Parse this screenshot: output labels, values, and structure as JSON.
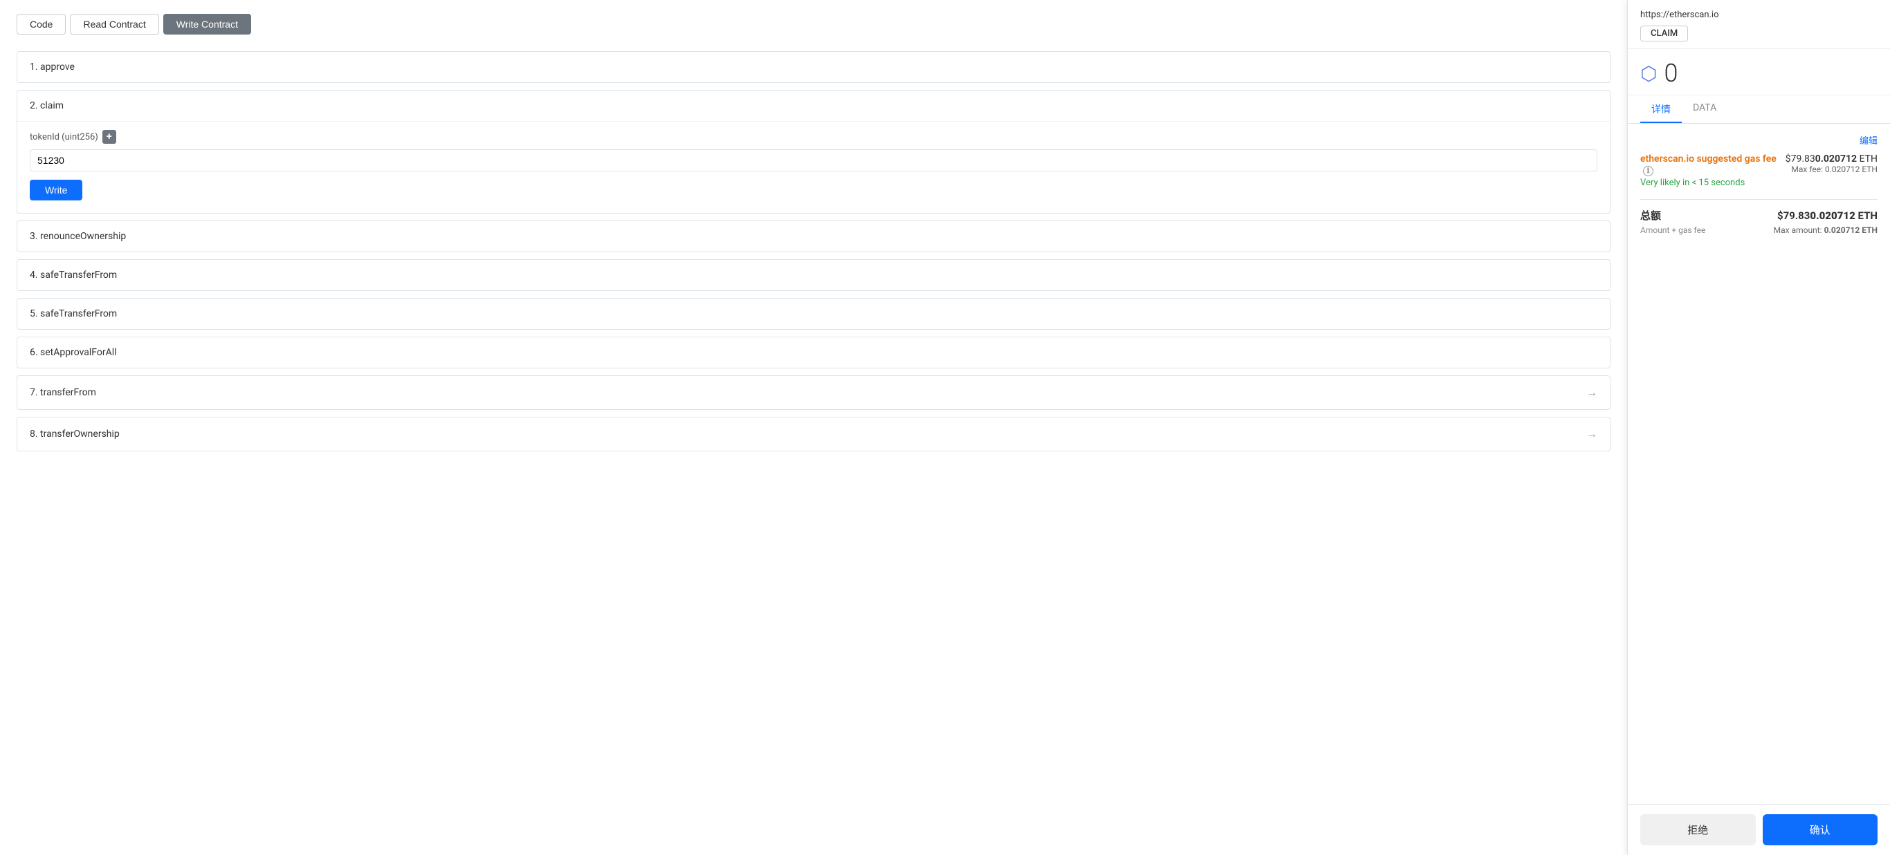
{
  "tabs": {
    "code": "Code",
    "read_contract": "Read Contract",
    "write_contract": "Write Contract",
    "active": "write_contract"
  },
  "contract_items": [
    {
      "id": 1,
      "label": "1. approve",
      "has_arrow": false
    },
    {
      "id": 2,
      "label": "2. claim",
      "expanded": true
    },
    {
      "id": 3,
      "label": "3. renounceOwnership",
      "has_arrow": false
    },
    {
      "id": 4,
      "label": "4. safeTransferFrom",
      "has_arrow": false
    },
    {
      "id": 5,
      "label": "5. safeTransferFrom",
      "has_arrow": false
    },
    {
      "id": 6,
      "label": "6. setApprovalForAll",
      "has_arrow": false
    },
    {
      "id": 7,
      "label": "7. transferFrom",
      "has_arrow": true
    },
    {
      "id": 8,
      "label": "8. transferOwnership",
      "has_arrow": true
    }
  ],
  "claim_section": {
    "header": "2. claim",
    "param_label": "tokenId (uint256)",
    "param_value": "51230",
    "param_placeholder": "",
    "write_button": "Write"
  },
  "metamask": {
    "url": "https://etherscan.io",
    "claim_badge": "CLAIM",
    "amount": "0",
    "eth_symbol": "◆",
    "tabs": {
      "details": "详情",
      "data": "DATA",
      "active": "details"
    },
    "edit_label": "编辑",
    "gas_fee": {
      "title": "etherscan.io suggested gas fee",
      "usd_prefix": "$79.83",
      "eth_value": "0.020712",
      "eth_unit": "ETH",
      "time_label": "Very likely in < 15 seconds",
      "max_fee_label": "Max fee:",
      "max_fee_value": "0.020712 ETH"
    },
    "total": {
      "label": "总额",
      "usd_prefix": "$79.83",
      "eth_value": "0.020712",
      "eth_unit": "ETH",
      "sub_label": "Amount + gas fee",
      "max_amount_label": "Max amount:",
      "max_amount_value": "0.020712 ETH"
    },
    "reject_button": "拒绝",
    "confirm_button": "确认"
  }
}
